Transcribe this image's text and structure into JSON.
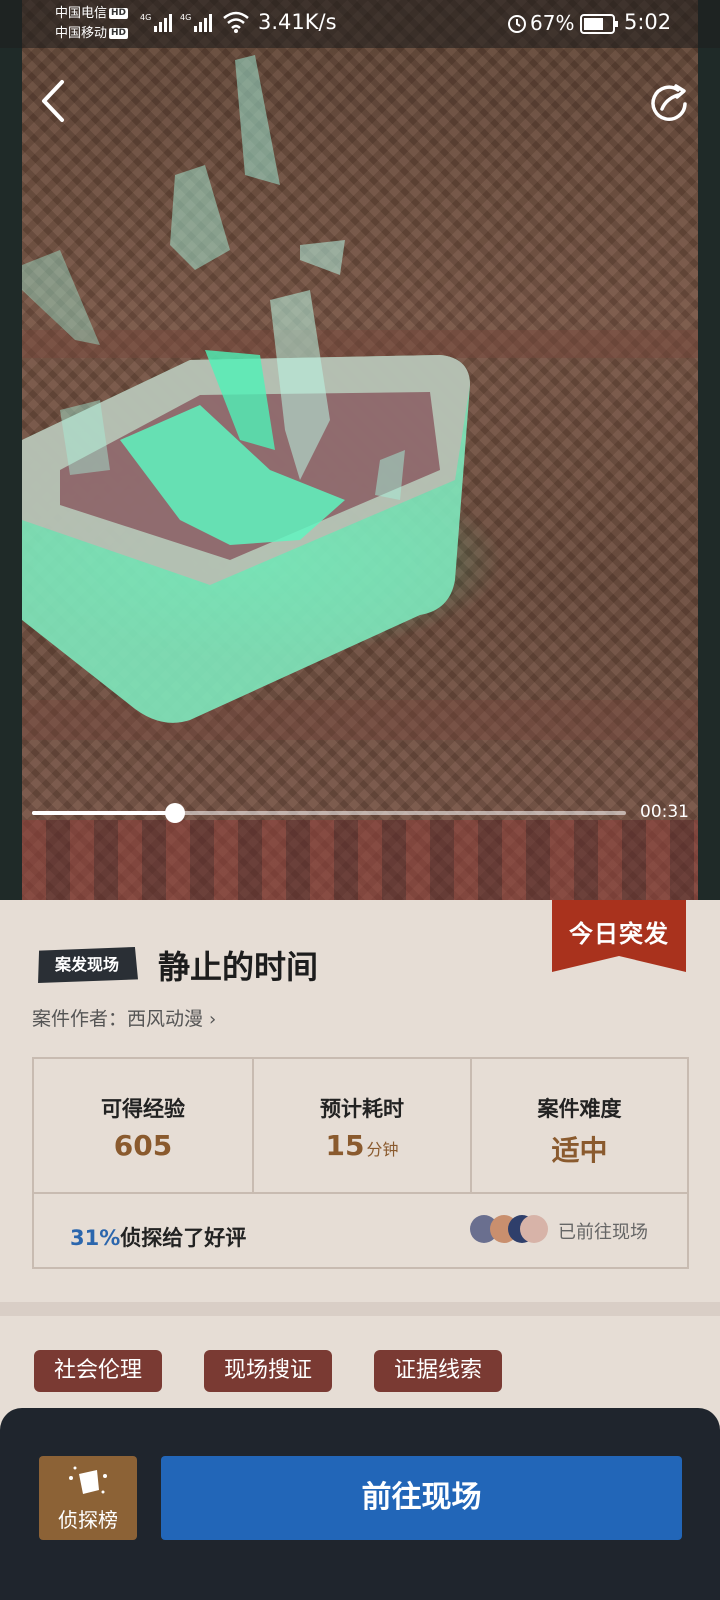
{
  "status_bar": {
    "carrier1": "中国电信",
    "carrier2": "中国移动",
    "hd_badge": "HD",
    "network": "4G",
    "speed": "3.41K/s",
    "battery": "67%",
    "time": "5:02"
  },
  "video": {
    "back_icon": "chevron-left-icon",
    "share_icon": "share-icon",
    "progress_fraction": 0.24,
    "current_time": "00:31"
  },
  "case": {
    "badge": "今日突发",
    "scene_tag": "案发现场",
    "title": "静止的时间",
    "author_label": "案件作者：",
    "author": "西风动漫",
    "stats": {
      "exp_label": "可得经验",
      "exp_value": "605",
      "time_label": "预计耗时",
      "time_value": "15",
      "time_unit": "分钟",
      "difficulty_label": "案件难度",
      "difficulty_value": "适中"
    },
    "rating_pct": "31%",
    "rating_text": "侦探给了好评",
    "visited_label": "已前往现场",
    "tags": [
      "社会伦理",
      "现场搜证",
      "证据线索"
    ]
  },
  "bottom": {
    "rank_label": "侦探榜",
    "go_label": "前往现场"
  },
  "colors": {
    "accent_blue": "#2266b8",
    "badge_red": "#a9321d",
    "value_brown": "#8a5a2e",
    "tag_red": "#7a3a33"
  }
}
